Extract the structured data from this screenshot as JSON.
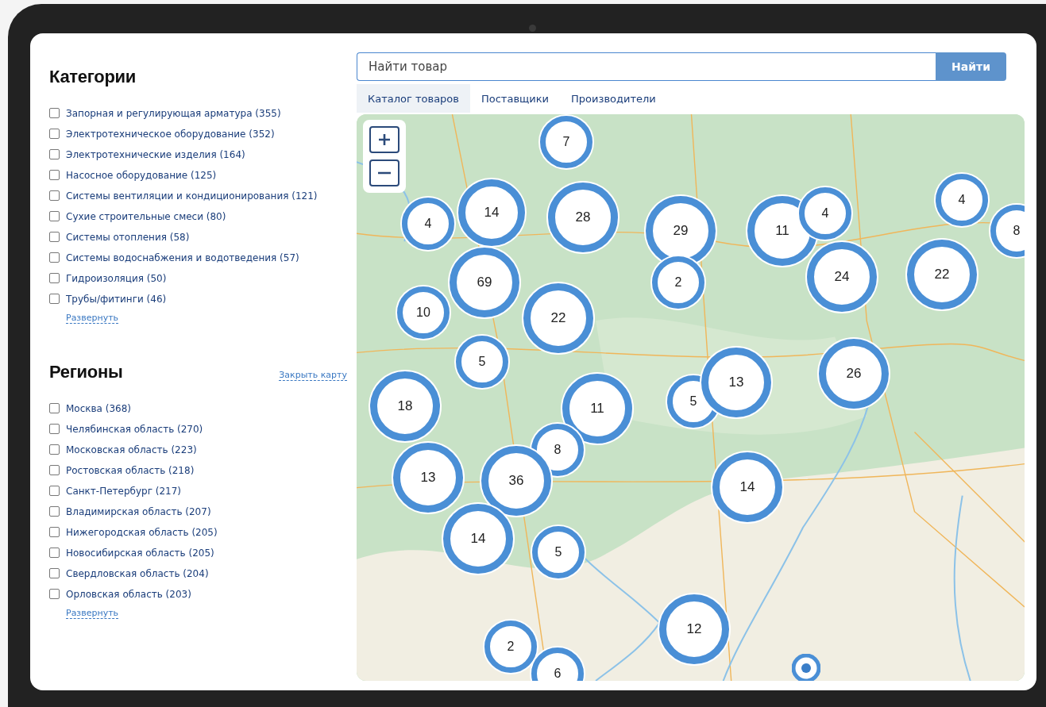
{
  "categories": {
    "title": "Категории",
    "items": [
      {
        "label": "Запорная и регулирующая арматура (355)",
        "checked": false
      },
      {
        "label": "Электротехническое оборудование (352)",
        "checked": false
      },
      {
        "label": "Электротехнические изделия (164)",
        "checked": false
      },
      {
        "label": "Насосное оборудование (125)",
        "checked": false
      },
      {
        "label": "Системы вентиляции и кондиционирования (121)",
        "checked": false
      },
      {
        "label": "Сухие строительные смеси (80)",
        "checked": false
      },
      {
        "label": "Системы отопления (58)",
        "checked": false
      },
      {
        "label": "Системы водоснабжения и водотведения (57)",
        "checked": false
      },
      {
        "label": "Гидроизоляция (50)",
        "checked": false
      },
      {
        "label": "Трубы/фитинги (46)",
        "checked": false
      }
    ],
    "expand_link": "Развернуть"
  },
  "regions": {
    "title": "Регионы",
    "close_map_link": "Закрыть карту",
    "items": [
      {
        "label": "Москва (368)",
        "checked": false
      },
      {
        "label": "Челябинская область (270)",
        "checked": false
      },
      {
        "label": "Московская область (223)",
        "checked": false
      },
      {
        "label": "Ростовская область (218)",
        "checked": false
      },
      {
        "label": "Санкт-Петербург (217)",
        "checked": false
      },
      {
        "label": "Владимирская область (207)",
        "checked": false
      },
      {
        "label": "Нижегородская область (205)",
        "checked": false
      },
      {
        "label": "Новосибирская область (205)",
        "checked": false
      },
      {
        "label": "Свердловская область (204)",
        "checked": false
      },
      {
        "label": "Орловская область (203)",
        "checked": false
      }
    ],
    "expand_link": "Развернуть"
  },
  "search": {
    "placeholder": "Найти товар",
    "button": "Найти"
  },
  "tabs": [
    {
      "label": "Каталог товаров",
      "selected": true
    },
    {
      "label": "Поставщики",
      "selected": false
    },
    {
      "label": "Производители",
      "selected": false
    }
  ],
  "map": {
    "clusters": [
      {
        "count": "7"
      },
      {
        "count": "4"
      },
      {
        "count": "14"
      },
      {
        "count": "28"
      },
      {
        "count": "29"
      },
      {
        "count": "2"
      },
      {
        "count": "11"
      },
      {
        "count": "4"
      },
      {
        "count": "24"
      },
      {
        "count": "4"
      },
      {
        "count": "22"
      },
      {
        "count": "8"
      },
      {
        "count": "69"
      },
      {
        "count": "10"
      },
      {
        "count": "22"
      },
      {
        "count": "5"
      },
      {
        "count": "18"
      },
      {
        "count": "11"
      },
      {
        "count": "5"
      },
      {
        "count": "13"
      },
      {
        "count": "26"
      },
      {
        "count": "8"
      },
      {
        "count": "13"
      },
      {
        "count": "36"
      },
      {
        "count": "14"
      },
      {
        "count": "14"
      },
      {
        "count": "5"
      },
      {
        "count": "12"
      },
      {
        "count": "2"
      },
      {
        "count": "6"
      }
    ]
  }
}
